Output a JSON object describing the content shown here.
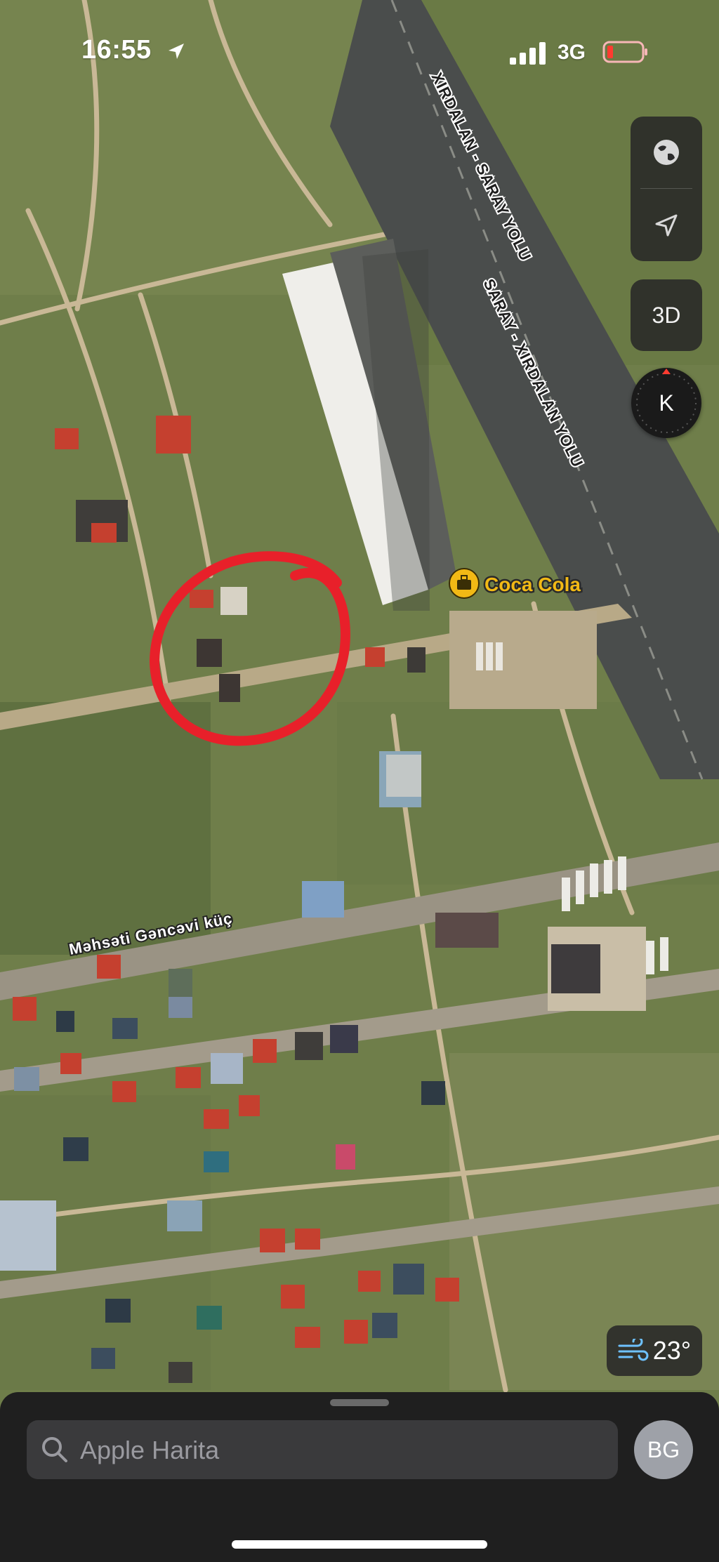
{
  "status_bar": {
    "time": "16:55",
    "network": "3G"
  },
  "map": {
    "roads": {
      "highway_north": "XIRDALAN - SARAY YOLU",
      "highway_south": "SARAY - XIRDALAN YOLU",
      "street": "Məhsəti Gəncəvi küç"
    },
    "poi": {
      "name": "Coca Cola",
      "icon": "briefcase-icon"
    },
    "highlight": {
      "color": "#e8202a"
    }
  },
  "controls": {
    "map_mode_icon": "globe-icon",
    "location_icon": "location-arrow-icon",
    "view_3d_label": "3D",
    "compass_label": "K"
  },
  "weather": {
    "icon": "wind-icon",
    "temperature": "23°"
  },
  "sheet": {
    "search_placeholder": "Apple Harita",
    "avatar_initials": "BG"
  }
}
